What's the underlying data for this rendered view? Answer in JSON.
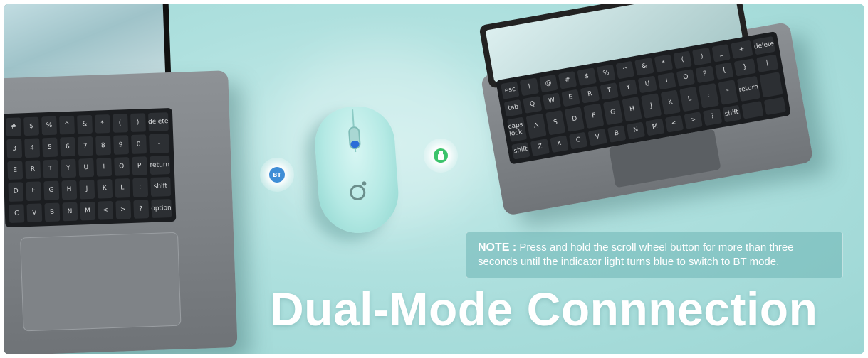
{
  "colors": {
    "background": "#aee0de",
    "mouse": "#b4e9e4",
    "bt_indicator": "#3f8ed6",
    "usb_indicator": "#3cc36b",
    "mouse_light": "#2b6dd8",
    "text": "#ffffff"
  },
  "indicators": {
    "bt_label": "BT",
    "usb_icon": "usb-receiver-icon"
  },
  "note": {
    "label": "NOTE :",
    "text": "Press and hold the scroll wheel button for more than three seconds until the indicator light turns blue to switch to BT mode."
  },
  "headline": "Dual-Mode Connnection",
  "left_keyboard_keys": [
    "#",
    "$",
    "%",
    "^",
    "&",
    "*",
    "(",
    ")",
    "delete",
    "3",
    "4",
    "5",
    "6",
    "7",
    "8",
    "9",
    "0",
    "-",
    "E",
    "R",
    "T",
    "Y",
    "U",
    "I",
    "O",
    "P",
    "return",
    "D",
    "F",
    "G",
    "H",
    "J",
    "K",
    "L",
    ":",
    "shift",
    "C",
    "V",
    "B",
    "N",
    "M",
    "<",
    ">",
    "?",
    "option"
  ],
  "right_keyboard_keys": [
    "esc",
    "!",
    "@",
    "#",
    "$",
    "%",
    "^",
    "&",
    "*",
    "(",
    ")",
    "_",
    "+",
    "delete",
    "tab",
    "Q",
    "W",
    "E",
    "R",
    "T",
    "Y",
    "U",
    "I",
    "O",
    "P",
    "{",
    "}",
    "|",
    "caps lock",
    "A",
    "S",
    "D",
    "F",
    "G",
    "H",
    "J",
    "K",
    "L",
    ":",
    "\"",
    "return",
    "",
    "shift",
    "Z",
    "X",
    "C",
    "V",
    "B",
    "N",
    "M",
    "<",
    ">",
    "?",
    "shift",
    "",
    ""
  ]
}
